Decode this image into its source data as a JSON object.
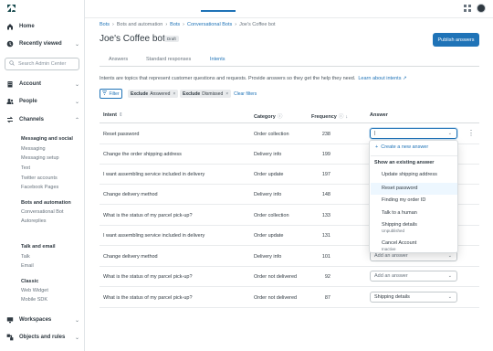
{
  "sidebar": {
    "logo": "Z",
    "home": "Home",
    "recently_viewed": "Recently viewed",
    "search_placeholder": "Search Admin Center",
    "account": "Account",
    "people": "People",
    "channels": "Channels",
    "sections": [
      {
        "title": "Messaging and social",
        "items": [
          "Messaging",
          "Messaging setup",
          "Text",
          "Twitter accounts",
          "Facebook Pages"
        ]
      },
      {
        "title": "Bots and automation",
        "items": [
          "Conversational Bot",
          "Autoreplies"
        ]
      },
      {
        "title": "Talk and email",
        "items": [
          "Talk",
          "Email"
        ]
      },
      {
        "title": "Classic",
        "items": [
          "Web Widget",
          "Mobile SDK"
        ]
      }
    ],
    "workspaces": "Workspaces",
    "objects_rules": "Objects and rules"
  },
  "breadcrumb": [
    "Bots",
    "Bots and automation",
    "Bots",
    "Conversational Bots",
    "Joe's Coffee bot"
  ],
  "page": {
    "title": "Joe's Coffee bot",
    "status": "Draft",
    "publish_label": "Publish answers"
  },
  "tabs": [
    "Answers",
    "Standard responses",
    "Intents"
  ],
  "intro": {
    "text": "Intents are topics that represent customer questions and requests. Provide answers so they get the help they need.",
    "link": "Learn about intents ↗"
  },
  "filters": {
    "button": "Filter",
    "chips": [
      {
        "bold": "Exclude",
        "text": "Answered"
      },
      {
        "bold": "Exclude",
        "text": "Dismissed"
      }
    ],
    "clear": "Clear filters"
  },
  "table": {
    "headers": [
      "Intent",
      "Category",
      "Frequency",
      "Answer"
    ],
    "rows": [
      {
        "intent": "Reset password",
        "category": "Order collection",
        "frequency": "238",
        "answer": "|"
      },
      {
        "intent": "Change the order shipping address",
        "category": "Delivery info",
        "frequency": "199",
        "answer": ""
      },
      {
        "intent": "I want assembling service included in delivery",
        "category": "Order update",
        "frequency": "197",
        "answer": ""
      },
      {
        "intent": "Change delivery method",
        "category": "Delivery info",
        "frequency": "148",
        "answer": ""
      },
      {
        "intent": "What is the status of my parcel pick-up?",
        "category": "Order collection",
        "frequency": "133",
        "answer": ""
      },
      {
        "intent": "I want assembling service included in delivery",
        "category": "Order update",
        "frequency": "131",
        "answer": ""
      },
      {
        "intent": "Change delivery method",
        "category": "Delivery info",
        "frequency": "101",
        "answer": "Add an answer"
      },
      {
        "intent": "What is the status of my parcel pick-up?",
        "category": "Order not delivered",
        "frequency": "92",
        "answer": "Add an answer"
      },
      {
        "intent": "What is the status of my parcel pick-up?",
        "category": "Order not delivered",
        "frequency": "87",
        "answer": "Shipping details"
      }
    ]
  },
  "menu": {
    "create": "Create a new answer",
    "heading": "Show an existing answer",
    "items": [
      {
        "label": "Update shipping address",
        "sub": ""
      },
      {
        "label": "Reset password",
        "sub": ""
      },
      {
        "label": "Finding my order ID",
        "sub": ""
      },
      {
        "label": "Talk to a human",
        "sub": ""
      },
      {
        "label": "Shipping details",
        "sub": "Unpublished"
      },
      {
        "label": "Cancel Account",
        "sub": "Inactive"
      }
    ]
  },
  "colors": {
    "accent": "#1f73b7",
    "text": "#2f3941",
    "muted": "#68737d"
  }
}
